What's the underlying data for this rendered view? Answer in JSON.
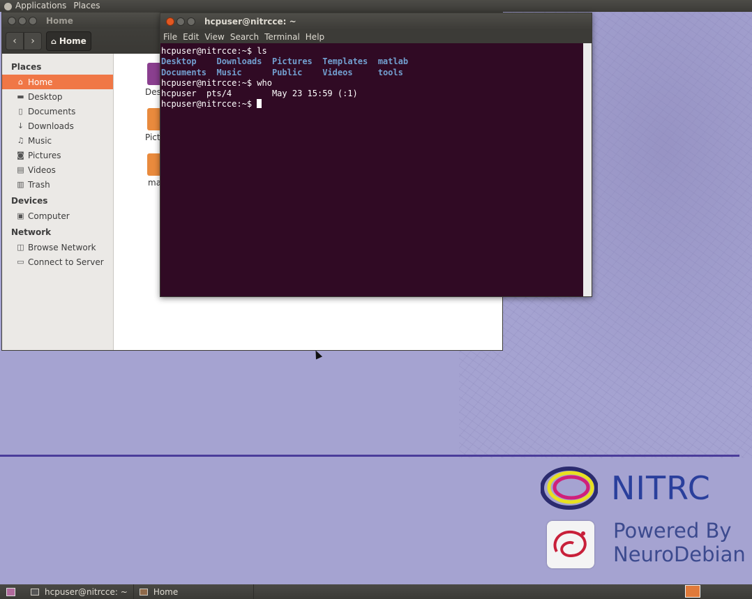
{
  "top_panel": {
    "applications": "Applications",
    "places": "Places"
  },
  "home_window": {
    "title": "Home",
    "path_button": "Home",
    "sidebar": {
      "places_heading": "Places",
      "places": [
        {
          "label": "Home",
          "icon": "home-icon"
        },
        {
          "label": "Desktop",
          "icon": "folder-icon"
        },
        {
          "label": "Documents",
          "icon": "document-icon"
        },
        {
          "label": "Downloads",
          "icon": "download-icon"
        },
        {
          "label": "Music",
          "icon": "music-icon"
        },
        {
          "label": "Pictures",
          "icon": "camera-icon"
        },
        {
          "label": "Videos",
          "icon": "film-icon"
        },
        {
          "label": "Trash",
          "icon": "trash-icon"
        }
      ],
      "devices_heading": "Devices",
      "devices": [
        {
          "label": "Computer",
          "icon": "drive-icon"
        }
      ],
      "network_heading": "Network",
      "network": [
        {
          "label": "Browse Network",
          "icon": "network-icon"
        },
        {
          "label": "Connect to Server",
          "icon": "server-icon"
        }
      ]
    },
    "files": [
      "Des",
      "Pict",
      "ma"
    ]
  },
  "terminal": {
    "title": "hcpuser@nitrcce: ~",
    "menu": [
      "File",
      "Edit",
      "View",
      "Search",
      "Terminal",
      "Help"
    ],
    "prompt": "hcpuser@nitrcce:~$",
    "cmd1": "ls",
    "ls_row1": [
      "Desktop",
      "Downloads",
      "Pictures",
      "Templates",
      "matlab"
    ],
    "ls_row2": [
      "Documents",
      "Music",
      "Public",
      "Videos",
      "tools"
    ],
    "cmd2": "who",
    "who_output": "hcpuser  pts/4        May 23 15:59 (:1)"
  },
  "desktop": {
    "brand": "NITRC",
    "powered_line1": "Powered By",
    "powered_line2": "NeuroDebian"
  },
  "taskbar": {
    "task1": "hcpuser@nitrcce: ~",
    "task2": "Home"
  }
}
